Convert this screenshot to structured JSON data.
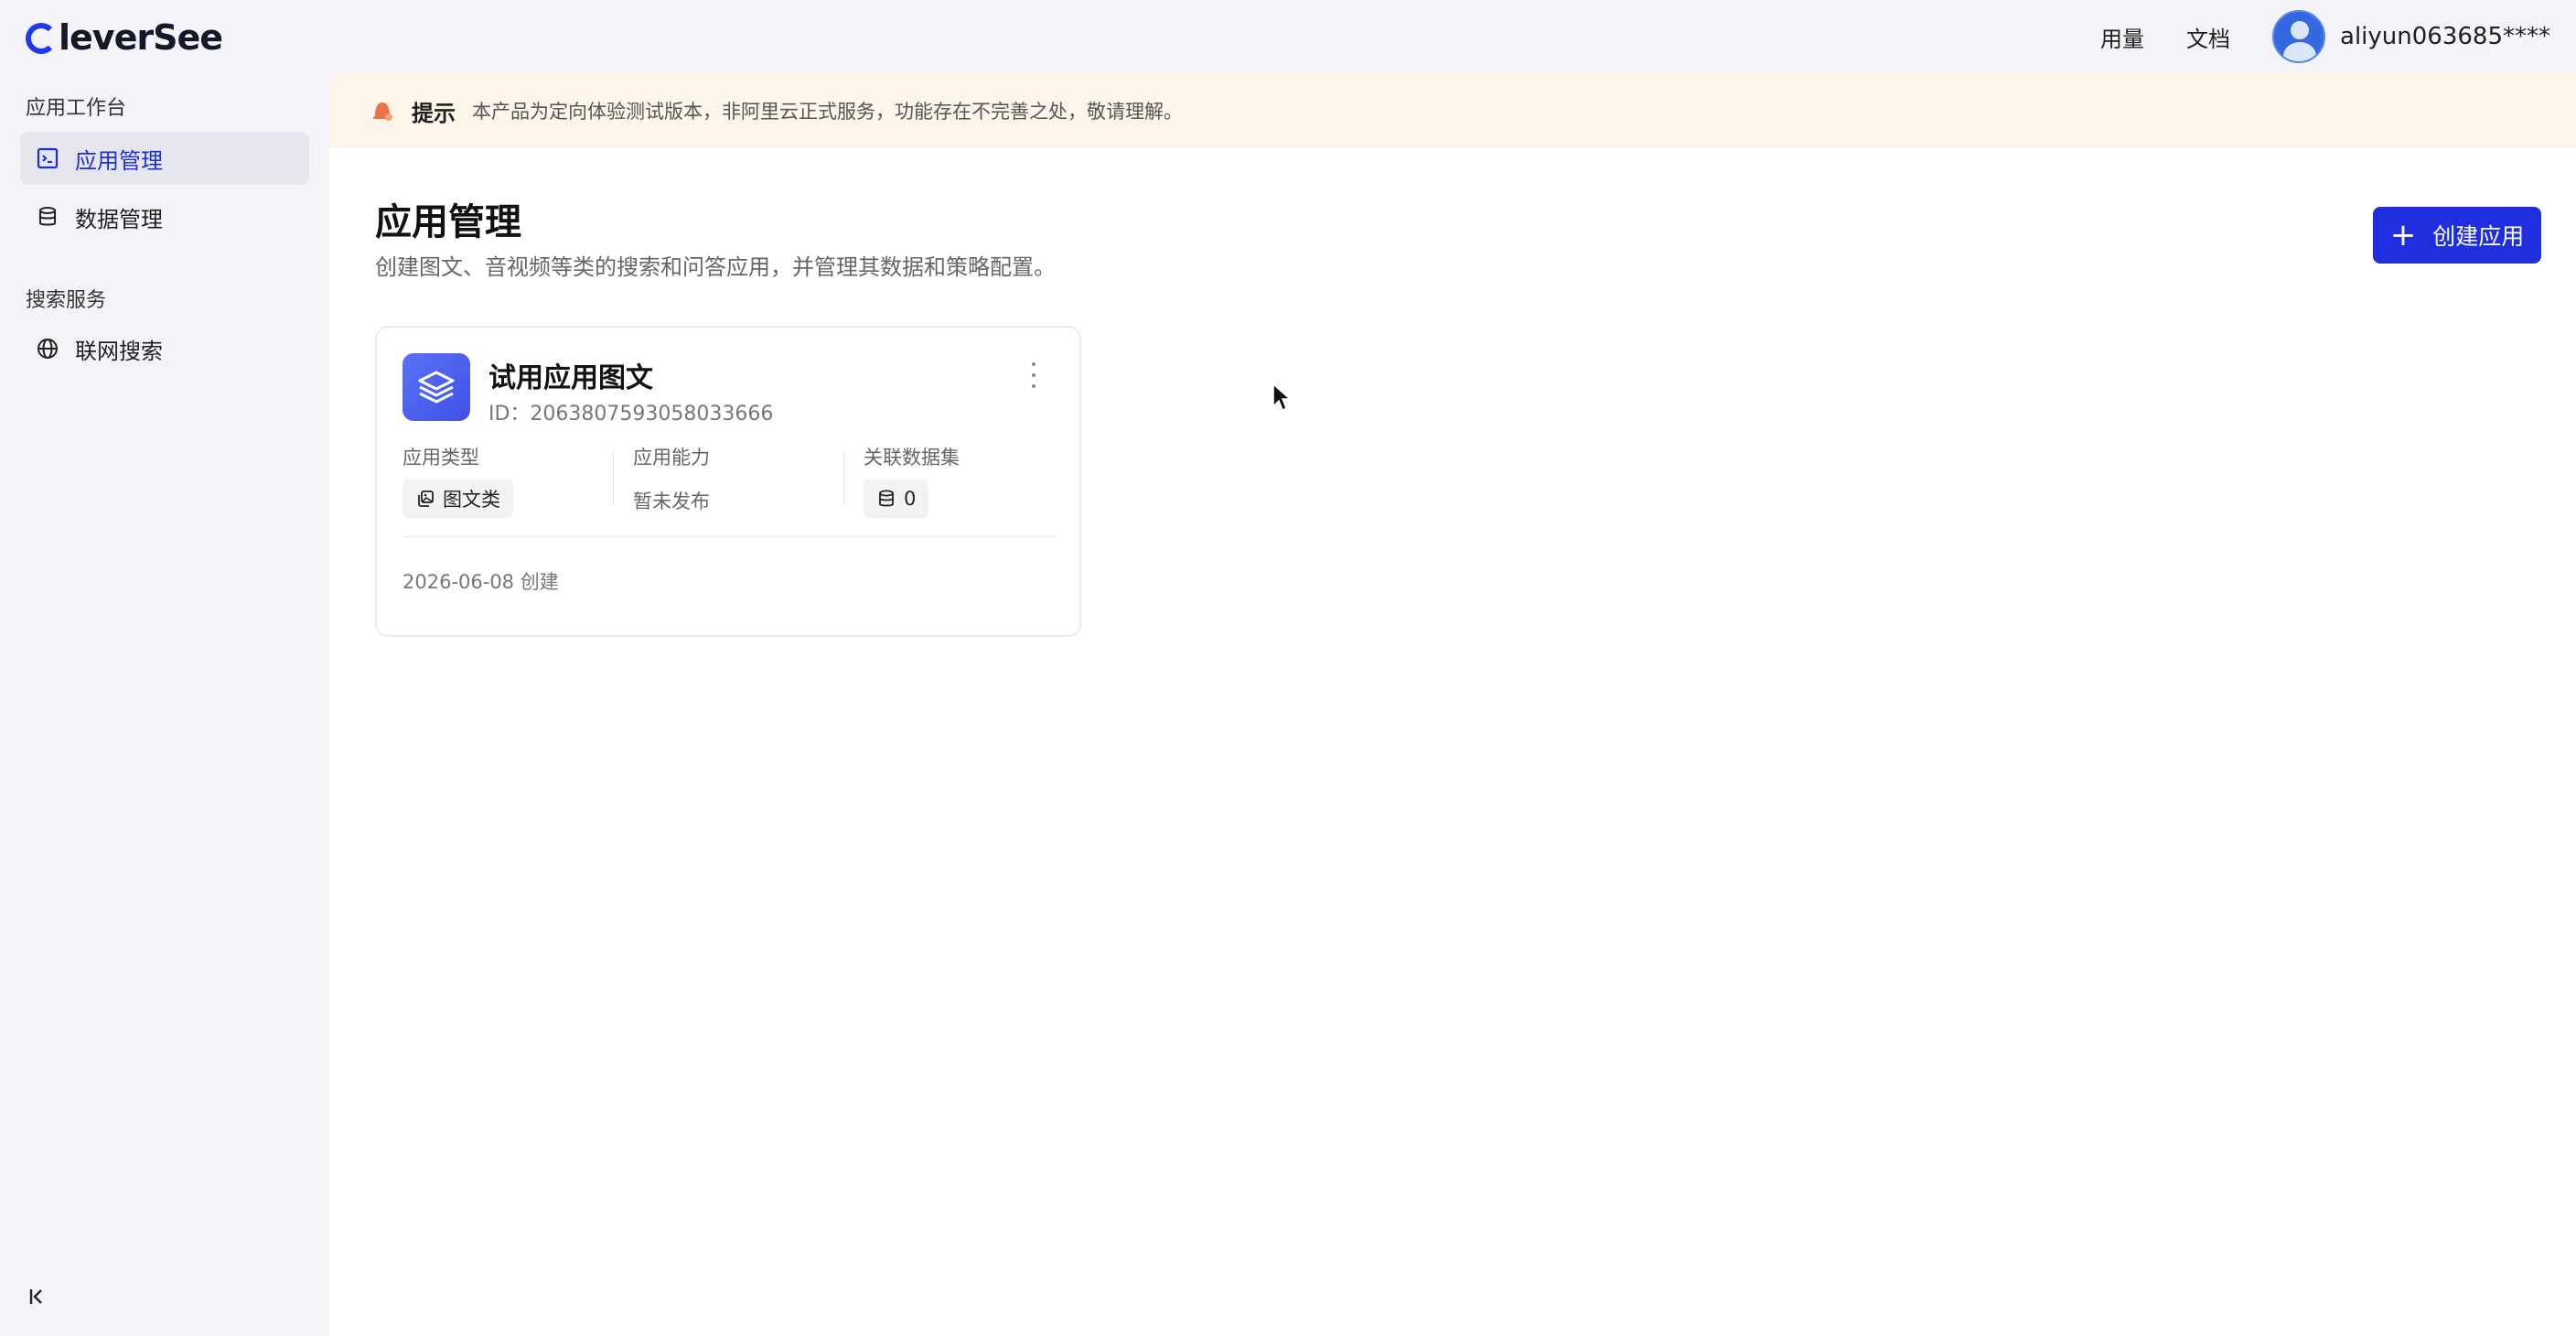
{
  "brand": {
    "name": "leverSee",
    "accent": "#1f2fe0"
  },
  "header": {
    "links": [
      "用量",
      "文档"
    ],
    "username": "aliyun063685****"
  },
  "sidebar": {
    "groups": [
      {
        "title": "应用工作台",
        "items": [
          {
            "label": "应用管理",
            "icon": "app-terminal-icon",
            "active": true
          },
          {
            "label": "数据管理",
            "icon": "database-icon",
            "active": false
          }
        ]
      },
      {
        "title": "搜索服务",
        "items": [
          {
            "label": "联网搜索",
            "icon": "globe-icon",
            "active": false
          }
        ]
      }
    ],
    "collapse_icon": "collapse-left-icon"
  },
  "notice": {
    "title": "提示",
    "text": "本产品为定向体验测试版本，非阿里云正式服务，功能存在不完善之处，敬请理解。",
    "bg": "#fdf5ea"
  },
  "page": {
    "title": "应用管理",
    "description": "创建图文、音视频等类的搜索和问答应用，并管理其数据和策略配置。",
    "create_label": "创建应用"
  },
  "apps": [
    {
      "name": "试用应用图文",
      "id_text": "ID：2063807593058033666",
      "type_label": "应用类型",
      "type_value": "图文类",
      "capability_label": "应用能力",
      "capability_value": "暂未发布",
      "dataset_label": "关联数据集",
      "dataset_count": "0",
      "created_text": "2026-06-08 创建"
    }
  ]
}
